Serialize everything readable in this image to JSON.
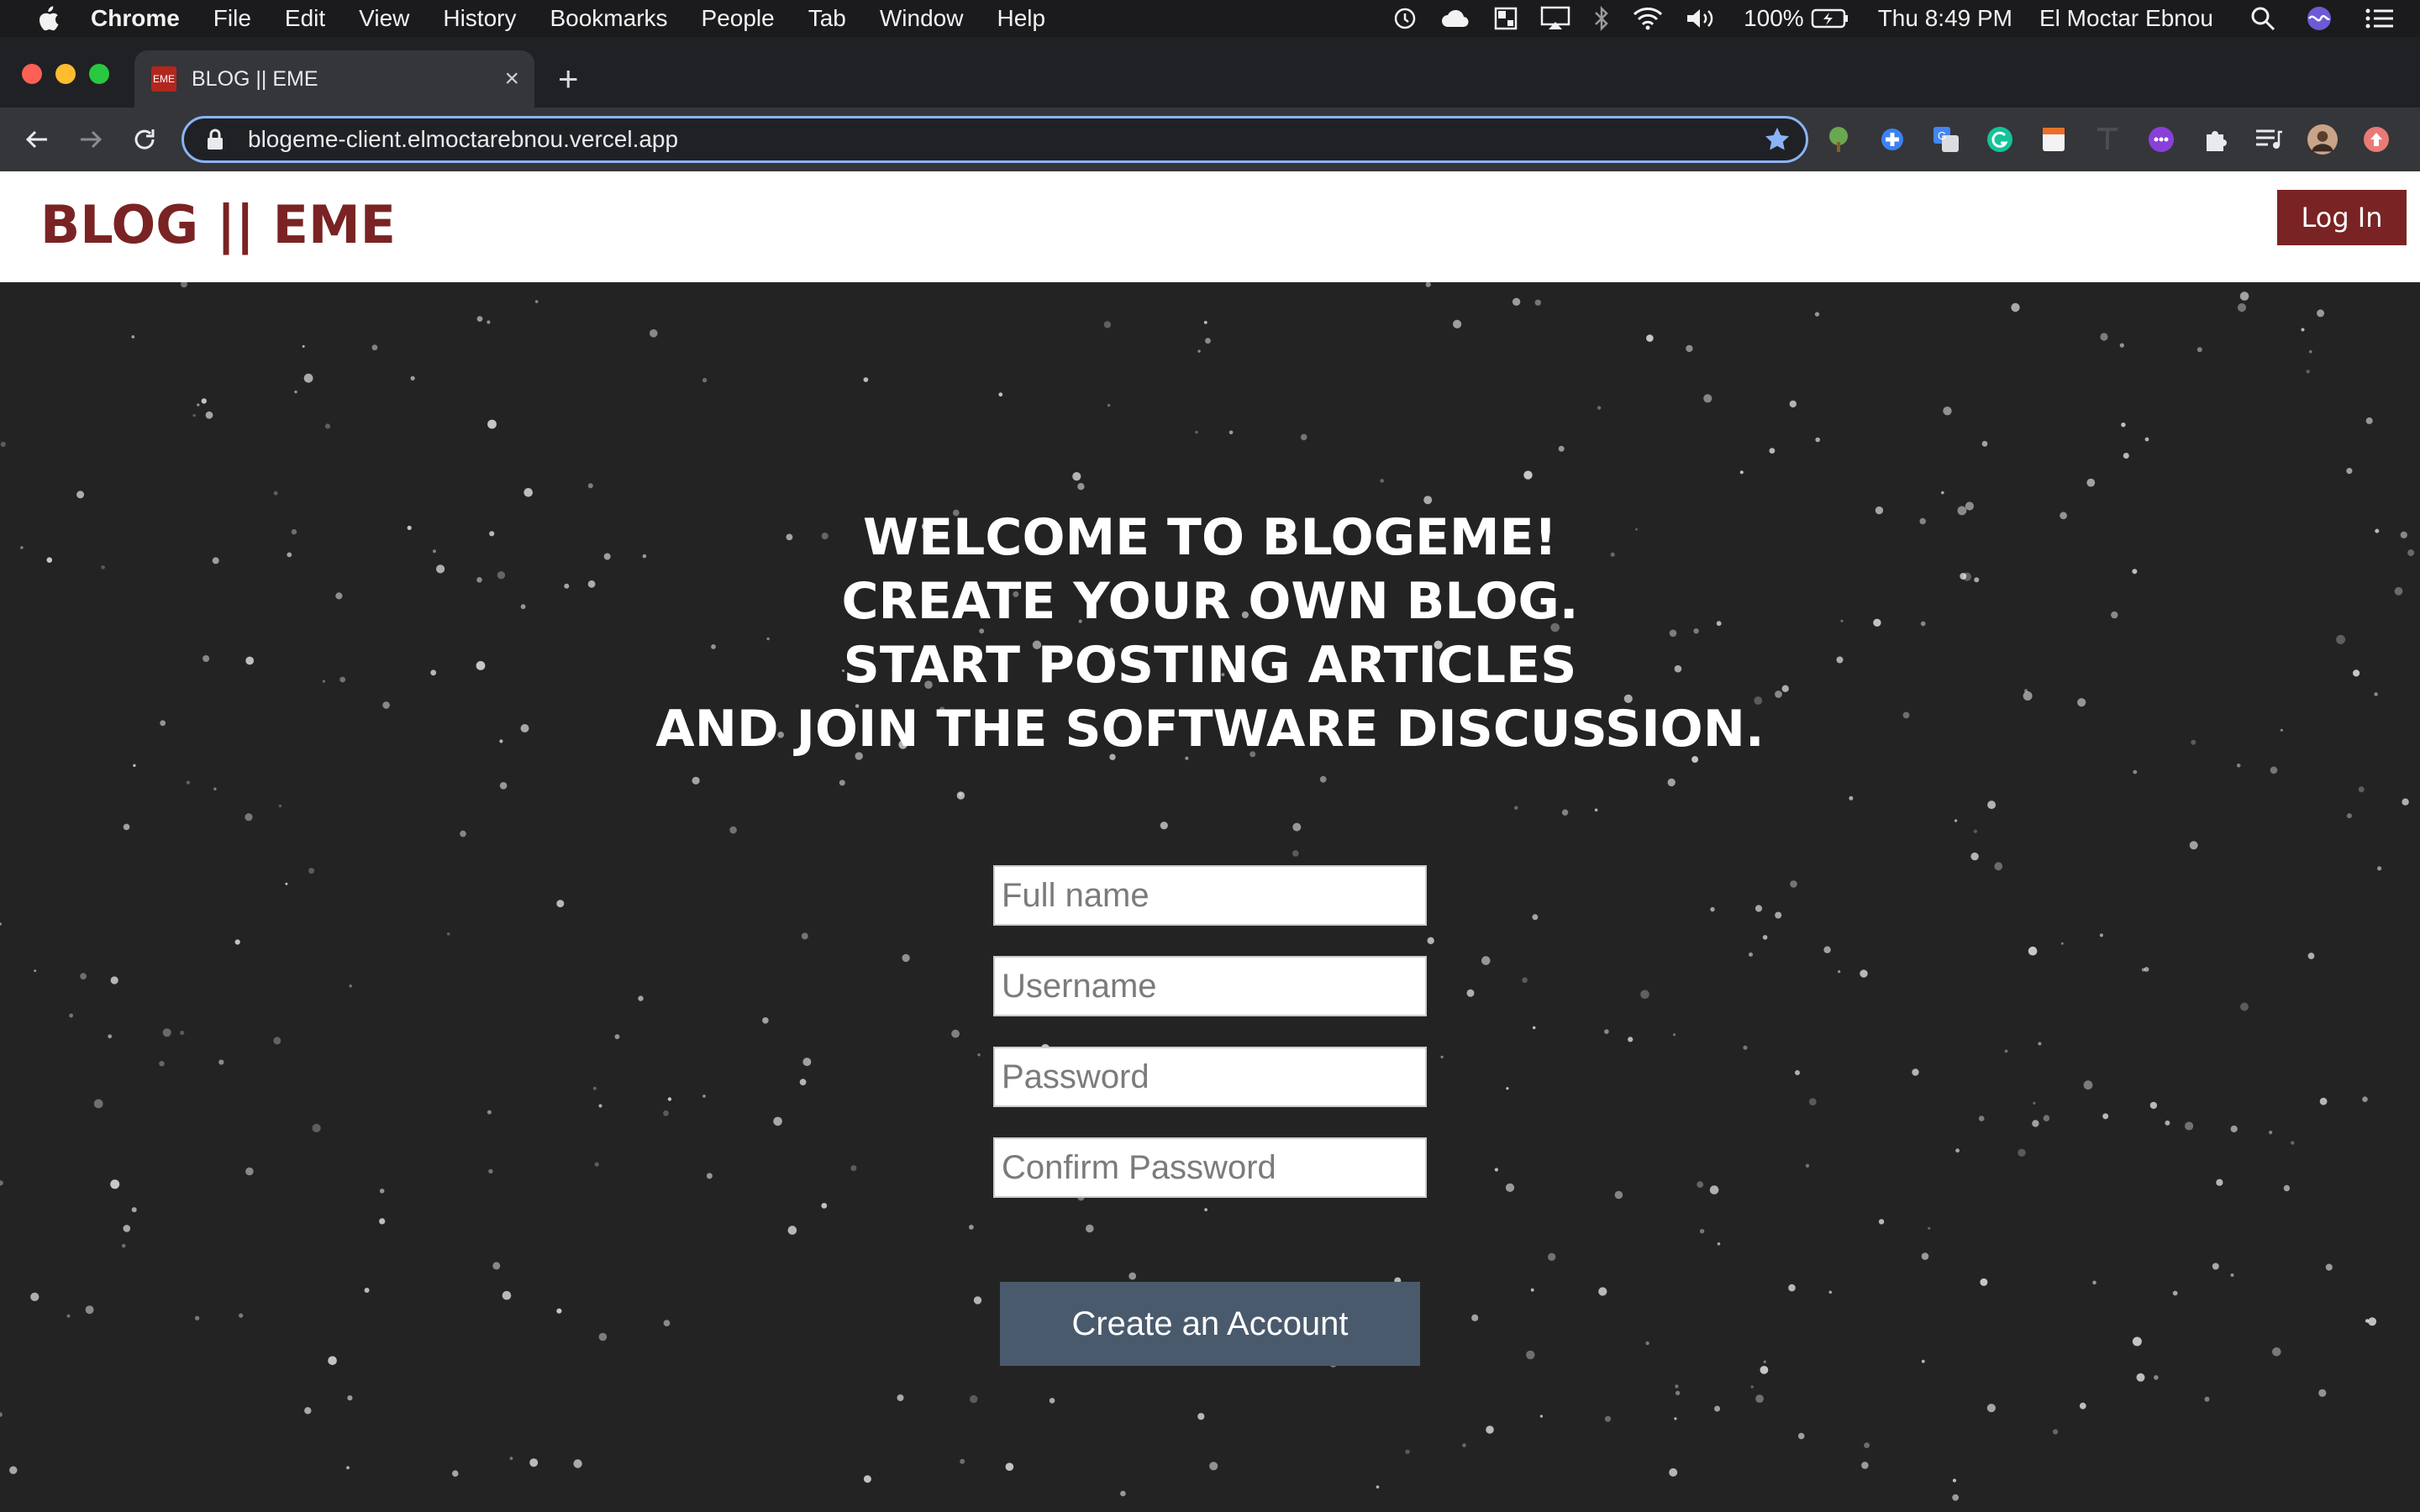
{
  "menubar": {
    "app": "Chrome",
    "items": [
      "File",
      "Edit",
      "View",
      "History",
      "Bookmarks",
      "People",
      "Tab",
      "Window",
      "Help"
    ],
    "battery": "100%",
    "clock": "Thu 8:49 PM",
    "user": "El Moctar Ebnou"
  },
  "browser": {
    "tab_favicon": "EME",
    "tab_title": "BLOG || EME",
    "url": "blogeme-client.elmoctarebnou.vercel.app"
  },
  "site": {
    "brand": "BLOG || EME",
    "login_label": "Log In",
    "hero_lines": [
      "WELCOME TO BLOGEME!",
      "CREATE YOUR OWN BLOG.",
      "START POSTING ARTICLES",
      "AND JOIN THE SOFTWARE DISCUSSION."
    ],
    "form": {
      "fullname_placeholder": "Full name",
      "username_placeholder": "Username",
      "password_placeholder": "Password",
      "confirm_placeholder": "Confirm Password",
      "submit_label": "Create an Account"
    }
  },
  "colors": {
    "brand": "#7a2324",
    "background": "#232323",
    "button": "#4a5a6d"
  }
}
